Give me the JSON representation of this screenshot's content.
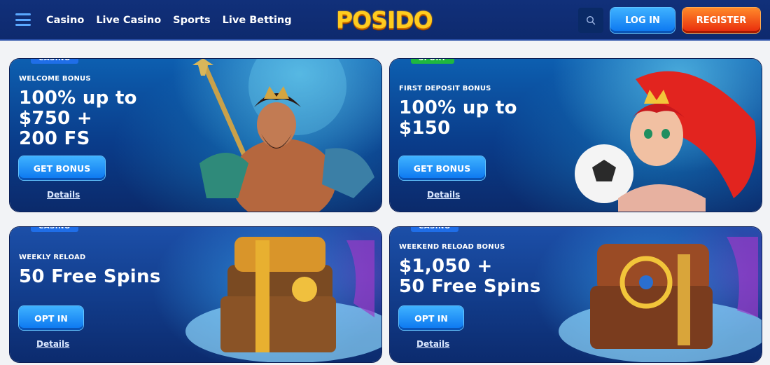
{
  "header": {
    "nav": [
      "Casino",
      "Live Casino",
      "Sports",
      "Live Betting"
    ],
    "logo_text": "POSIDO",
    "login_label": "LOG IN",
    "register_label": "REGISTER"
  },
  "cards": [
    {
      "tag": "CASINO",
      "eyebrow": "WELCOME BONUS",
      "headline": [
        "100% up to",
        "$750 +",
        "200 FS"
      ],
      "cta": "GET BONUS",
      "details": "Details"
    },
    {
      "tag": "SPORT",
      "eyebrow": "FIRST DEPOSIT BONUS",
      "headline": [
        "100% up to",
        "$150"
      ],
      "cta": "GET BONUS",
      "details": "Details"
    },
    {
      "tag": "CASINO",
      "eyebrow": "WEEKLY RELOAD",
      "headline": [
        "50 Free Spins"
      ],
      "cta": "OPT IN",
      "details": "Details"
    },
    {
      "tag": "CASINO",
      "eyebrow": "WEEKEND RELOAD BONUS",
      "headline": [
        "$1,050 +",
        "50 Free Spins"
      ],
      "cta": "OPT IN",
      "details": "Details"
    }
  ],
  "colors": {
    "header_bg": "#11307a",
    "accent_blue": "#0a75f0",
    "register_orange": "#e8280b",
    "tag_casino": "#1f6ee8",
    "tag_sport": "#1fb83f",
    "logo_yellow": "#ffcc1f"
  },
  "icons": [
    "hamburger-menu-icon",
    "search-icon"
  ]
}
